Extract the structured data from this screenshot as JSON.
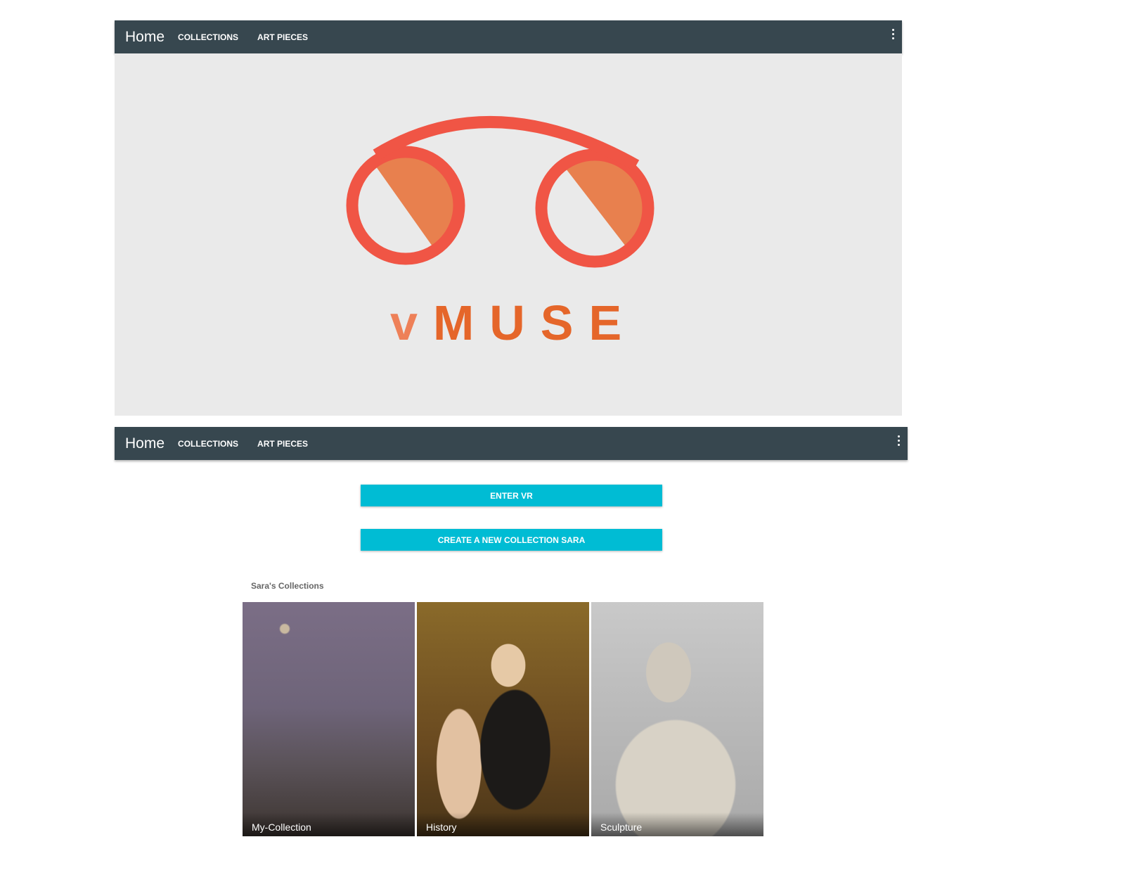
{
  "top_nav": {
    "title": "Home",
    "links": [
      "COLLECTIONS",
      "ART PIECES"
    ]
  },
  "hero": {
    "logo_text": "vMUSE",
    "colors": {
      "ring": "#f05545",
      "fill": "#e8804e",
      "text": "#e5662a",
      "v": "#ee8058"
    }
  },
  "nav": {
    "title": "Home",
    "links": [
      "COLLECTIONS",
      "ART PIECES"
    ]
  },
  "buttons": {
    "enter_vr": "ENTER VR",
    "create_collection": "CREATE A NEW COLLECTION SARA"
  },
  "collections": {
    "heading": "Sara's Collections",
    "items": [
      {
        "label": "My-Collection"
      },
      {
        "label": "History"
      },
      {
        "label": "Sculpture"
      }
    ]
  },
  "colors": {
    "nav_bg": "#37474f",
    "accent": "#00bcd4"
  }
}
